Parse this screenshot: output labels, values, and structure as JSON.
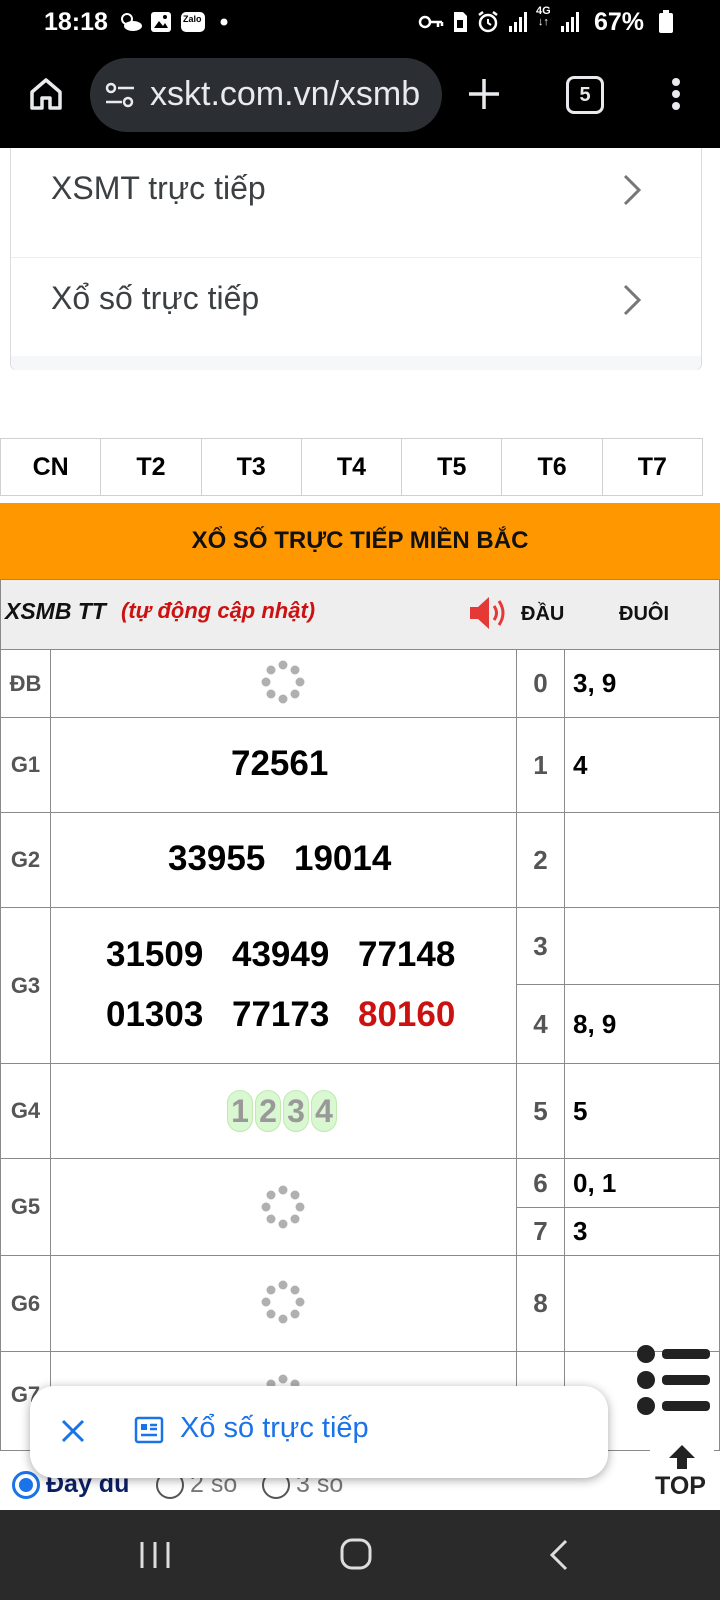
{
  "status_bar": {
    "time": "18:18",
    "battery": "67%",
    "network": "4G",
    "left_icons": [
      "weather-icon",
      "gallery-icon",
      "zalo-icon",
      "dot-icon"
    ],
    "zalo_label": "Zalo",
    "right_icons": [
      "key-icon",
      "sim-icon",
      "alarm-icon",
      "signal-icon",
      "signal-icon",
      "battery-icon"
    ]
  },
  "browser": {
    "url": "xskt.com.vn/xsmb",
    "tab_count": "5"
  },
  "menu": {
    "items": [
      {
        "label": "XSMT trực tiếp"
      },
      {
        "label": "Xổ số trực tiếp"
      }
    ]
  },
  "day_tabs": [
    "CN",
    "T2",
    "T3",
    "T4",
    "T5",
    "T6",
    "T7"
  ],
  "header_title": "XỔ SỐ TRỰC TIẾP MIỀN BẮC",
  "results": {
    "label_xsmb": "XSMB TT",
    "label_auto": "(tự động cập nhật)",
    "col_dau": "ĐẦU",
    "col_duoi": "ĐUÔI",
    "prizes": {
      "db": {
        "label": "ĐB"
      },
      "g1": {
        "label": "G1",
        "numbers": [
          "72561"
        ]
      },
      "g2": {
        "label": "G2",
        "numbers": [
          "33955",
          "19014"
        ]
      },
      "g3": {
        "label": "G3",
        "numbers": [
          "31509",
          "43949",
          "77148",
          "01303",
          "77173",
          "80160"
        ],
        "highlight_color": "#cc1111"
      },
      "g4": {
        "label": "G4",
        "placeholder_digits": [
          "1",
          "2",
          "3",
          "4"
        ]
      },
      "g5": {
        "label": "G5"
      },
      "g6": {
        "label": "G6"
      },
      "g7": {
        "label": "G7"
      }
    },
    "dau_duoi": [
      {
        "dau": "0",
        "duoi": "3, 9"
      },
      {
        "dau": "1",
        "duoi": "4"
      },
      {
        "dau": "2",
        "duoi": ""
      },
      {
        "dau": "3",
        "duoi": ""
      },
      {
        "dau": "4",
        "duoi": "8, 9"
      },
      {
        "dau": "5",
        "duoi": "5"
      },
      {
        "dau": "6",
        "duoi": "0, 1"
      },
      {
        "dau": "7",
        "duoi": "3"
      },
      {
        "dau": "8",
        "duoi": ""
      }
    ]
  },
  "bottom_sheet": {
    "title": "Xổ số trực tiếp"
  },
  "top_button": "TOP",
  "radio_options": [
    {
      "label": "Đầy đủ",
      "selected": true
    },
    {
      "label": "2 số",
      "selected": false
    },
    {
      "label": "3 số",
      "selected": false
    }
  ],
  "colors": {
    "orange_header": "#ff9800",
    "accent_blue": "#1a73e8",
    "red_label": "#cc1111",
    "navy_label": "#0b1f66"
  }
}
